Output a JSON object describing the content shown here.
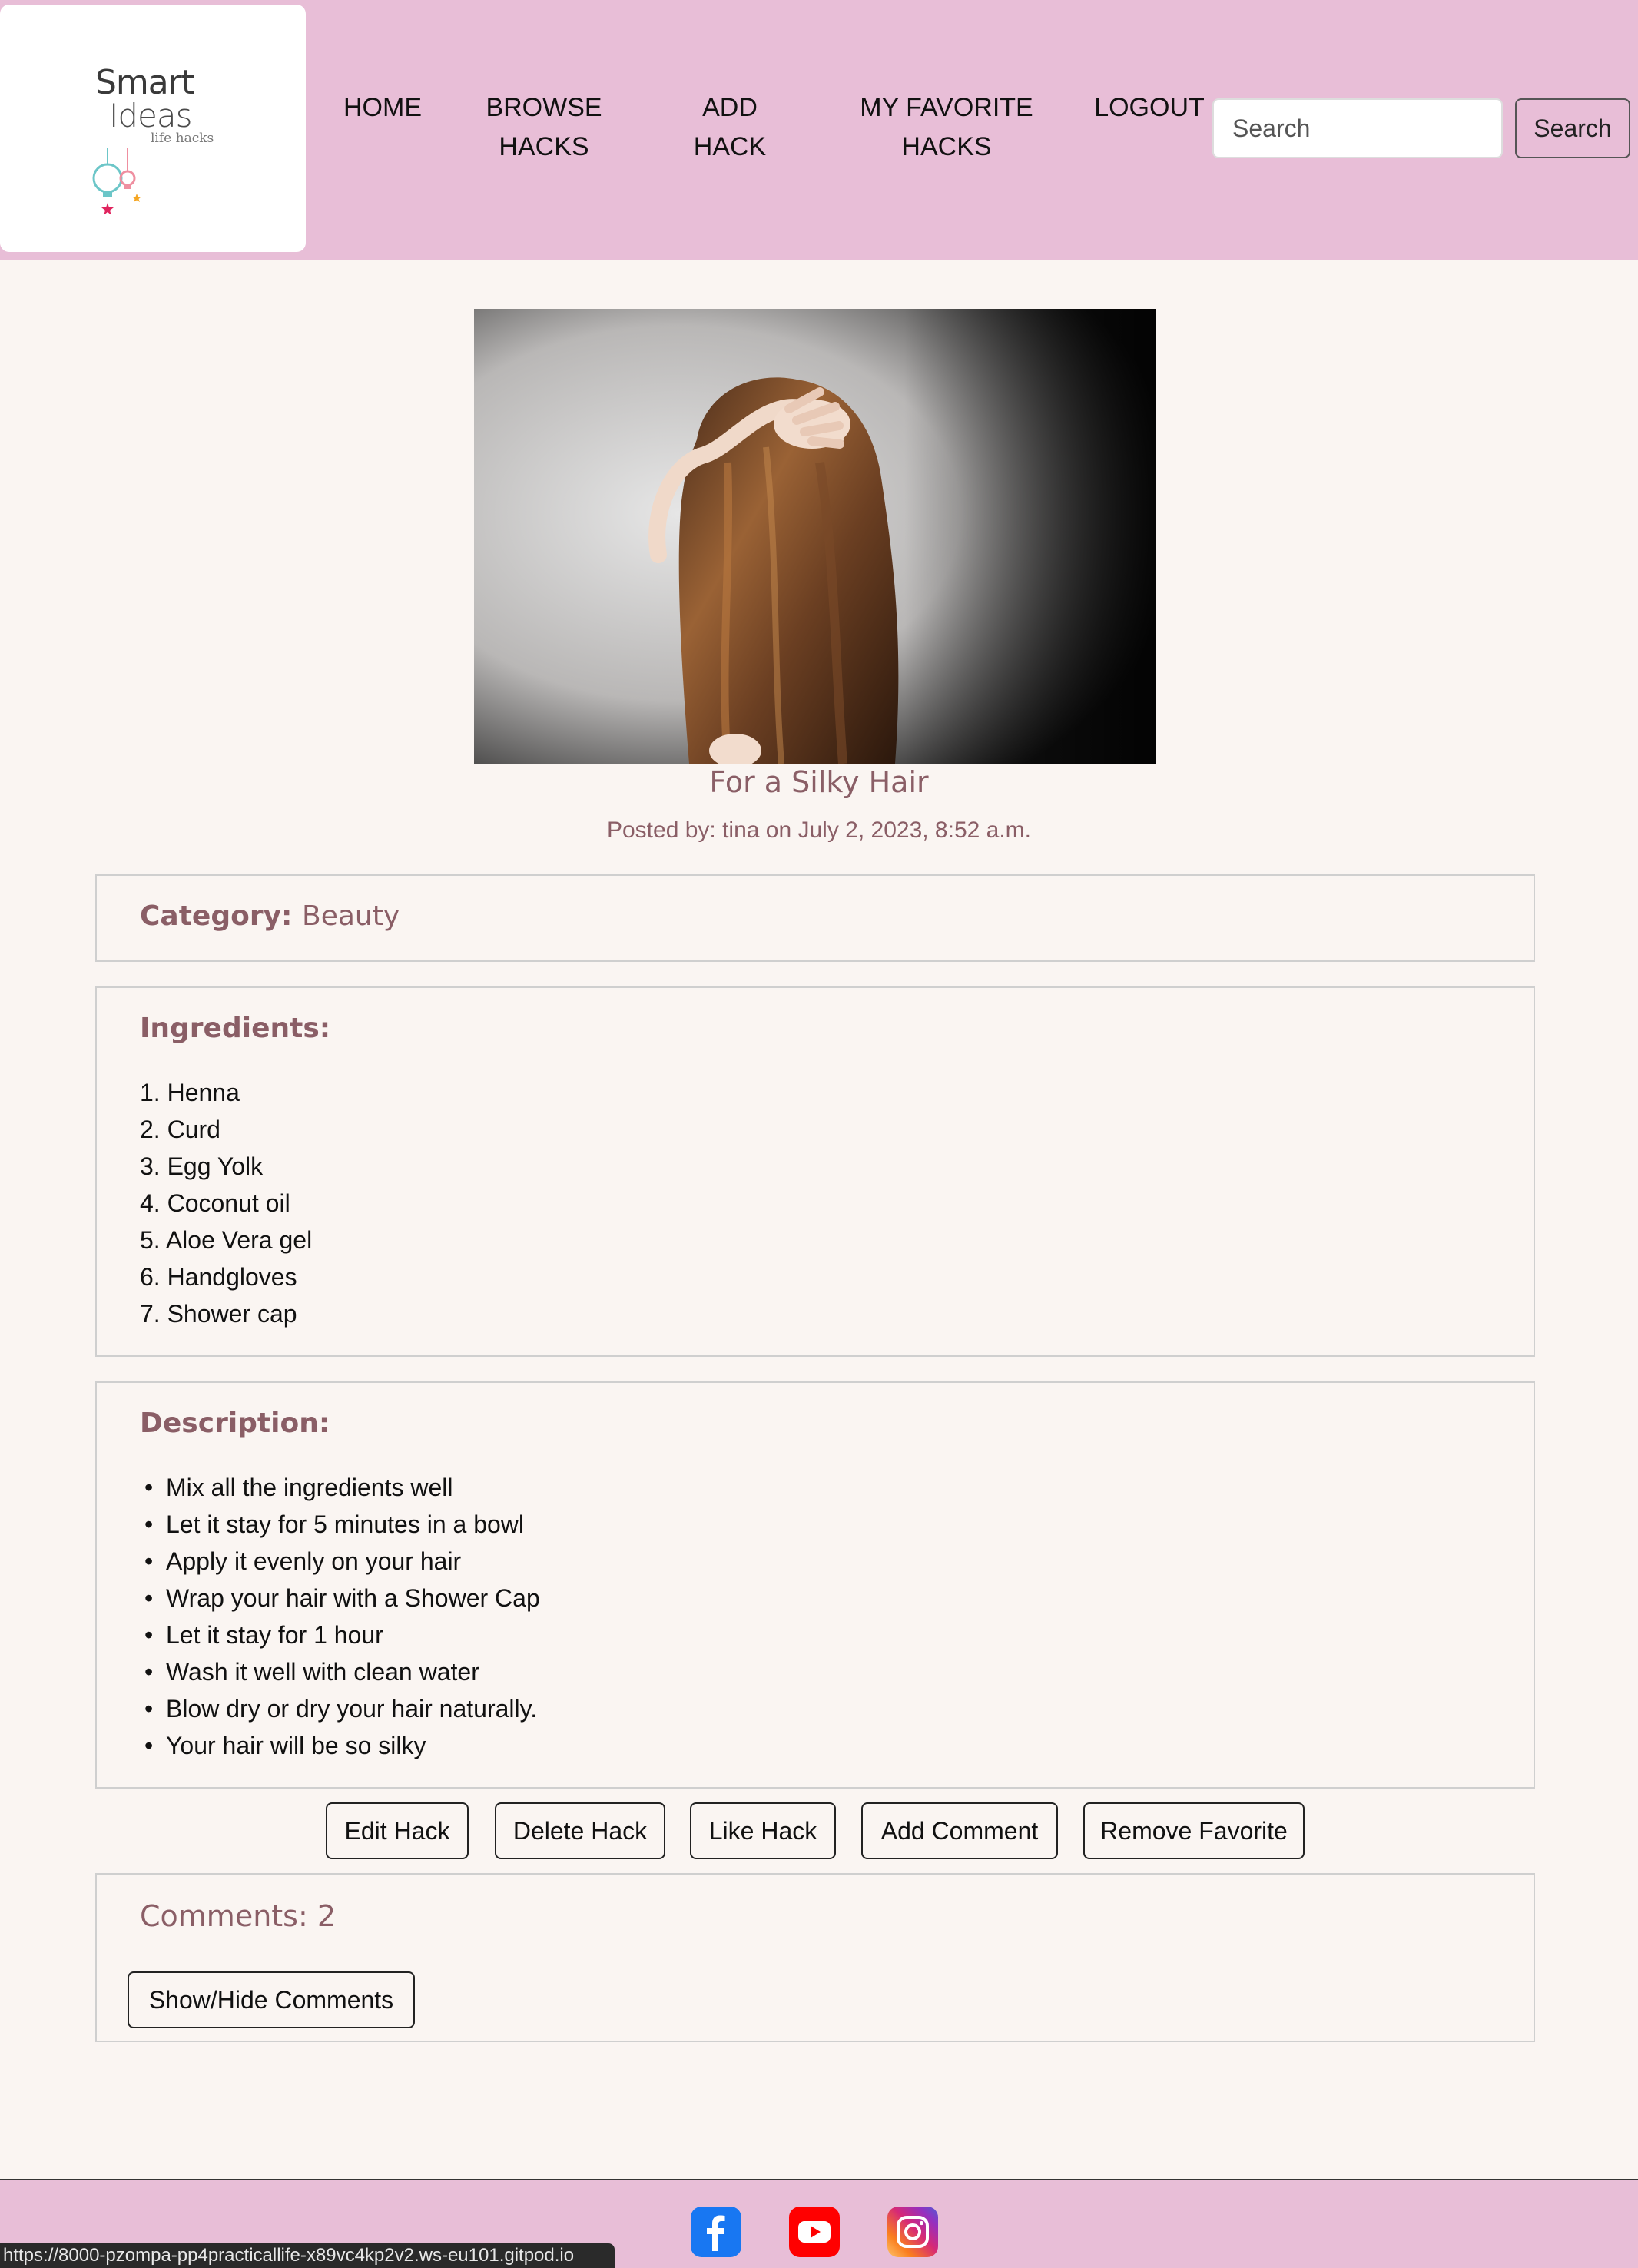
{
  "brand": {
    "logo_line1": "Smart",
    "logo_line2": "Ideas",
    "logo_tagline": "life hacks"
  },
  "nav": {
    "home": "HOME",
    "browse": "BROWSE HACKS",
    "add": "ADD HACK",
    "favorites": "MY FAVORITE HACKS",
    "logout": "LOGOUT"
  },
  "search": {
    "placeholder": "Search",
    "button_label": "Search"
  },
  "hack": {
    "title": "For a Silky Hair",
    "meta": "Posted by: tina on July 2, 2023, 8:52 a.m.",
    "category_label": "Category:",
    "category_value": "Beauty",
    "ingredients_heading": "Ingredients:",
    "ingredients": [
      "1. Henna",
      "2. Curd",
      "3. Egg Yolk",
      "4. Coconut oil",
      "5. Aloe Vera gel",
      "6. Handgloves",
      "7. Shower cap"
    ],
    "description_heading": "Description:",
    "description": [
      "Mix all the ingredients well",
      "Let it stay for 5 minutes in a bowl",
      "Apply it evenly on your hair",
      "Wrap your hair with a Shower Cap",
      "Let it stay for 1 hour",
      "Wash it well with clean water",
      "Blow dry or dry your hair naturally.",
      "Your hair will be so silky"
    ]
  },
  "actions": {
    "edit": "Edit Hack",
    "delete": "Delete Hack",
    "like": "Like Hack",
    "comment": "Add Comment",
    "remove_favorite": "Remove Favorite"
  },
  "comments": {
    "count_label": "Comments: 2",
    "toggle_label": "Show/Hide Comments"
  },
  "footer": {
    "icons": [
      "facebook-icon",
      "youtube-icon",
      "instagram-icon"
    ]
  },
  "status_bar": {
    "url": "https://8000-pzompa-pp4practicallife-x89vc4kp2v2.ws-eu101.gitpod.io"
  },
  "colors": {
    "nav_background": "#e8bed7",
    "page_background": "#faf5f2",
    "accent_text": "#8a5e66"
  }
}
